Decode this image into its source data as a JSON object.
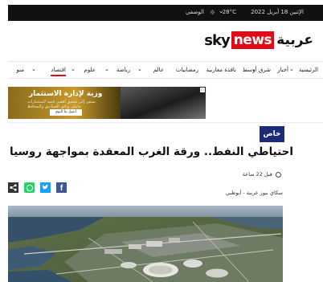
{
  "topbar": {
    "date": "الإثنين 18 أبريل 2022",
    "weather_temp": "28°C",
    "city": "الوصفي"
  },
  "logo": {
    "sky": "sky",
    "news": "news",
    "arabia": "عربية"
  },
  "nav": {
    "items": [
      {
        "label": "الرئيسية"
      },
      {
        "label": "أخبار"
      },
      {
        "label": "شرق أوسط"
      },
      {
        "label": "نافذة مغاربية"
      },
      {
        "label": "رمضانيات"
      },
      {
        "label": "عالم"
      },
      {
        "label": "رياضة"
      },
      {
        "label": "علوم"
      },
      {
        "label": "اقتصاد"
      },
      {
        "label": "منو"
      }
    ]
  },
  "ad": {
    "title": "وزية لإدارة الاستثمار",
    "subtitle_1": "نسعى إلى تحقيق أقصى قيمة لاستثمارات",
    "subtitle_2": "حاملي وثائق الصناديق والمحافظ",
    "button": "اتصل بنا اليوم"
  },
  "article": {
    "badge": "خاص",
    "headline": "احتياطي النفط.. ورقة الغرب المعقدة بمواجهة روسيا",
    "time": "قبل 22 ساعة",
    "source": "سكاي نيوز عربية - أبوظبي"
  },
  "colors": {
    "brand_red": "#e20a17",
    "badge_blue": "#1c2a7a",
    "facebook": "#3b5998",
    "twitter": "#1da1f2",
    "whatsapp": "#25d366",
    "share": "#333333"
  }
}
